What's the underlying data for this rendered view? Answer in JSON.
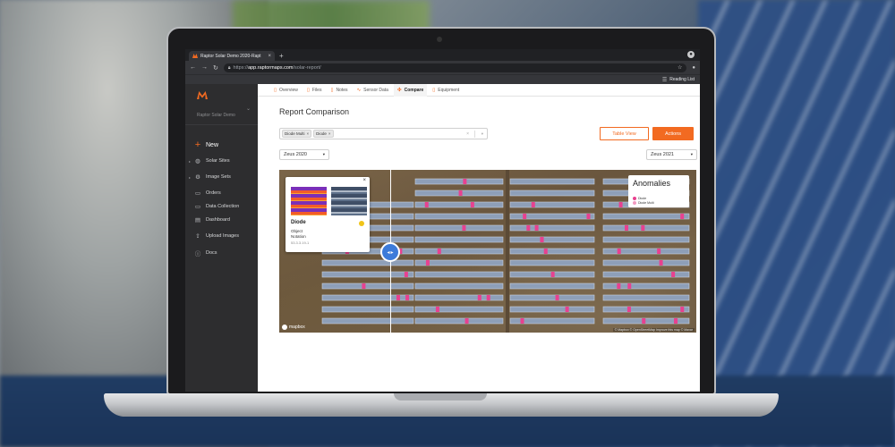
{
  "browser": {
    "tab_title": "Raptor Solar Demo 2020-Rapt",
    "tab_close": "×",
    "new_tab": "+",
    "url_prefix": "https://",
    "url_host": "app.raptormaps.com",
    "url_path": "/solar-report/",
    "reading_list": "Reading List",
    "nav_back": "←",
    "nav_forward": "→",
    "nav_reload": "↻",
    "star": "☆"
  },
  "sidebar": {
    "site_name": "Raptor Solar Demo",
    "new_label": "New",
    "items": [
      {
        "label": "Solar Sites",
        "icon": "globe-icon",
        "glyph": "◍"
      },
      {
        "label": "Image Sets",
        "icon": "gear-icon",
        "glyph": "⚙"
      },
      {
        "label": "Orders",
        "icon": "document-icon",
        "glyph": "▭"
      },
      {
        "label": "Data Collection",
        "icon": "document-icon",
        "glyph": "▭"
      },
      {
        "label": "Dashboard",
        "icon": "dashboard-icon",
        "glyph": "▤"
      },
      {
        "label": "Upload Images",
        "icon": "upload-icon",
        "glyph": "⇪"
      },
      {
        "label": "Docs",
        "icon": "info-icon",
        "glyph": "ⓘ"
      }
    ]
  },
  "tabs": [
    {
      "label": "Overview",
      "glyph": "▯"
    },
    {
      "label": "Files",
      "glyph": "▯"
    },
    {
      "label": "Notes",
      "glyph": "▯"
    },
    {
      "label": "Sensor Data",
      "glyph": "∿"
    },
    {
      "label": "Compare",
      "glyph": "✣"
    },
    {
      "label": "Equipment",
      "glyph": "▯"
    }
  ],
  "page": {
    "title": "Report Comparison",
    "chips": [
      "Diode Multi",
      "Diode"
    ],
    "table_view": "Table View",
    "actions": "Actions",
    "left_select": "Zeus 2020",
    "right_select": "Zeus 2021"
  },
  "popup": {
    "title": "Diode",
    "line1": "Object",
    "line2": "Notation",
    "line3": "53.3.3.19-1"
  },
  "legend": {
    "title": "Anomalies",
    "items": [
      {
        "label": "Diode",
        "color": "#e8418f"
      },
      {
        "label": "Diode Multi",
        "color": "#f29ac0"
      }
    ]
  },
  "map": {
    "mapbox": "mapbox",
    "attribution": "© Mapbox © OpenStreetMap Improve this map © Maxar"
  },
  "colors": {
    "accent": "#f26a21",
    "anomaly": "#e8418f"
  }
}
